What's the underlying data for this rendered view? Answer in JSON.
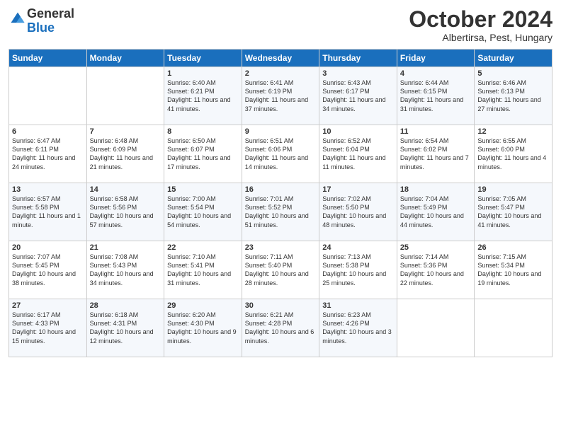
{
  "header": {
    "logo_general": "General",
    "logo_blue": "Blue",
    "month_title": "October 2024",
    "subtitle": "Albertirsa, Pest, Hungary"
  },
  "weekdays": [
    "Sunday",
    "Monday",
    "Tuesday",
    "Wednesday",
    "Thursday",
    "Friday",
    "Saturday"
  ],
  "weeks": [
    [
      {
        "day": "",
        "sunrise": "",
        "sunset": "",
        "daylight": ""
      },
      {
        "day": "",
        "sunrise": "",
        "sunset": "",
        "daylight": ""
      },
      {
        "day": "1",
        "sunrise": "Sunrise: 6:40 AM",
        "sunset": "Sunset: 6:21 PM",
        "daylight": "Daylight: 11 hours and 41 minutes."
      },
      {
        "day": "2",
        "sunrise": "Sunrise: 6:41 AM",
        "sunset": "Sunset: 6:19 PM",
        "daylight": "Daylight: 11 hours and 37 minutes."
      },
      {
        "day": "3",
        "sunrise": "Sunrise: 6:43 AM",
        "sunset": "Sunset: 6:17 PM",
        "daylight": "Daylight: 11 hours and 34 minutes."
      },
      {
        "day": "4",
        "sunrise": "Sunrise: 6:44 AM",
        "sunset": "Sunset: 6:15 PM",
        "daylight": "Daylight: 11 hours and 31 minutes."
      },
      {
        "day": "5",
        "sunrise": "Sunrise: 6:46 AM",
        "sunset": "Sunset: 6:13 PM",
        "daylight": "Daylight: 11 hours and 27 minutes."
      }
    ],
    [
      {
        "day": "6",
        "sunrise": "Sunrise: 6:47 AM",
        "sunset": "Sunset: 6:11 PM",
        "daylight": "Daylight: 11 hours and 24 minutes."
      },
      {
        "day": "7",
        "sunrise": "Sunrise: 6:48 AM",
        "sunset": "Sunset: 6:09 PM",
        "daylight": "Daylight: 11 hours and 21 minutes."
      },
      {
        "day": "8",
        "sunrise": "Sunrise: 6:50 AM",
        "sunset": "Sunset: 6:07 PM",
        "daylight": "Daylight: 11 hours and 17 minutes."
      },
      {
        "day": "9",
        "sunrise": "Sunrise: 6:51 AM",
        "sunset": "Sunset: 6:06 PM",
        "daylight": "Daylight: 11 hours and 14 minutes."
      },
      {
        "day": "10",
        "sunrise": "Sunrise: 6:52 AM",
        "sunset": "Sunset: 6:04 PM",
        "daylight": "Daylight: 11 hours and 11 minutes."
      },
      {
        "day": "11",
        "sunrise": "Sunrise: 6:54 AM",
        "sunset": "Sunset: 6:02 PM",
        "daylight": "Daylight: 11 hours and 7 minutes."
      },
      {
        "day": "12",
        "sunrise": "Sunrise: 6:55 AM",
        "sunset": "Sunset: 6:00 PM",
        "daylight": "Daylight: 11 hours and 4 minutes."
      }
    ],
    [
      {
        "day": "13",
        "sunrise": "Sunrise: 6:57 AM",
        "sunset": "Sunset: 5:58 PM",
        "daylight": "Daylight: 11 hours and 1 minute."
      },
      {
        "day": "14",
        "sunrise": "Sunrise: 6:58 AM",
        "sunset": "Sunset: 5:56 PM",
        "daylight": "Daylight: 10 hours and 57 minutes."
      },
      {
        "day": "15",
        "sunrise": "Sunrise: 7:00 AM",
        "sunset": "Sunset: 5:54 PM",
        "daylight": "Daylight: 10 hours and 54 minutes."
      },
      {
        "day": "16",
        "sunrise": "Sunrise: 7:01 AM",
        "sunset": "Sunset: 5:52 PM",
        "daylight": "Daylight: 10 hours and 51 minutes."
      },
      {
        "day": "17",
        "sunrise": "Sunrise: 7:02 AM",
        "sunset": "Sunset: 5:50 PM",
        "daylight": "Daylight: 10 hours and 48 minutes."
      },
      {
        "day": "18",
        "sunrise": "Sunrise: 7:04 AM",
        "sunset": "Sunset: 5:49 PM",
        "daylight": "Daylight: 10 hours and 44 minutes."
      },
      {
        "day": "19",
        "sunrise": "Sunrise: 7:05 AM",
        "sunset": "Sunset: 5:47 PM",
        "daylight": "Daylight: 10 hours and 41 minutes."
      }
    ],
    [
      {
        "day": "20",
        "sunrise": "Sunrise: 7:07 AM",
        "sunset": "Sunset: 5:45 PM",
        "daylight": "Daylight: 10 hours and 38 minutes."
      },
      {
        "day": "21",
        "sunrise": "Sunrise: 7:08 AM",
        "sunset": "Sunset: 5:43 PM",
        "daylight": "Daylight: 10 hours and 34 minutes."
      },
      {
        "day": "22",
        "sunrise": "Sunrise: 7:10 AM",
        "sunset": "Sunset: 5:41 PM",
        "daylight": "Daylight: 10 hours and 31 minutes."
      },
      {
        "day": "23",
        "sunrise": "Sunrise: 7:11 AM",
        "sunset": "Sunset: 5:40 PM",
        "daylight": "Daylight: 10 hours and 28 minutes."
      },
      {
        "day": "24",
        "sunrise": "Sunrise: 7:13 AM",
        "sunset": "Sunset: 5:38 PM",
        "daylight": "Daylight: 10 hours and 25 minutes."
      },
      {
        "day": "25",
        "sunrise": "Sunrise: 7:14 AM",
        "sunset": "Sunset: 5:36 PM",
        "daylight": "Daylight: 10 hours and 22 minutes."
      },
      {
        "day": "26",
        "sunrise": "Sunrise: 7:15 AM",
        "sunset": "Sunset: 5:34 PM",
        "daylight": "Daylight: 10 hours and 19 minutes."
      }
    ],
    [
      {
        "day": "27",
        "sunrise": "Sunrise: 6:17 AM",
        "sunset": "Sunset: 4:33 PM",
        "daylight": "Daylight: 10 hours and 15 minutes."
      },
      {
        "day": "28",
        "sunrise": "Sunrise: 6:18 AM",
        "sunset": "Sunset: 4:31 PM",
        "daylight": "Daylight: 10 hours and 12 minutes."
      },
      {
        "day": "29",
        "sunrise": "Sunrise: 6:20 AM",
        "sunset": "Sunset: 4:30 PM",
        "daylight": "Daylight: 10 hours and 9 minutes."
      },
      {
        "day": "30",
        "sunrise": "Sunrise: 6:21 AM",
        "sunset": "Sunset: 4:28 PM",
        "daylight": "Daylight: 10 hours and 6 minutes."
      },
      {
        "day": "31",
        "sunrise": "Sunrise: 6:23 AM",
        "sunset": "Sunset: 4:26 PM",
        "daylight": "Daylight: 10 hours and 3 minutes."
      },
      {
        "day": "",
        "sunrise": "",
        "sunset": "",
        "daylight": ""
      },
      {
        "day": "",
        "sunrise": "",
        "sunset": "",
        "daylight": ""
      }
    ]
  ]
}
